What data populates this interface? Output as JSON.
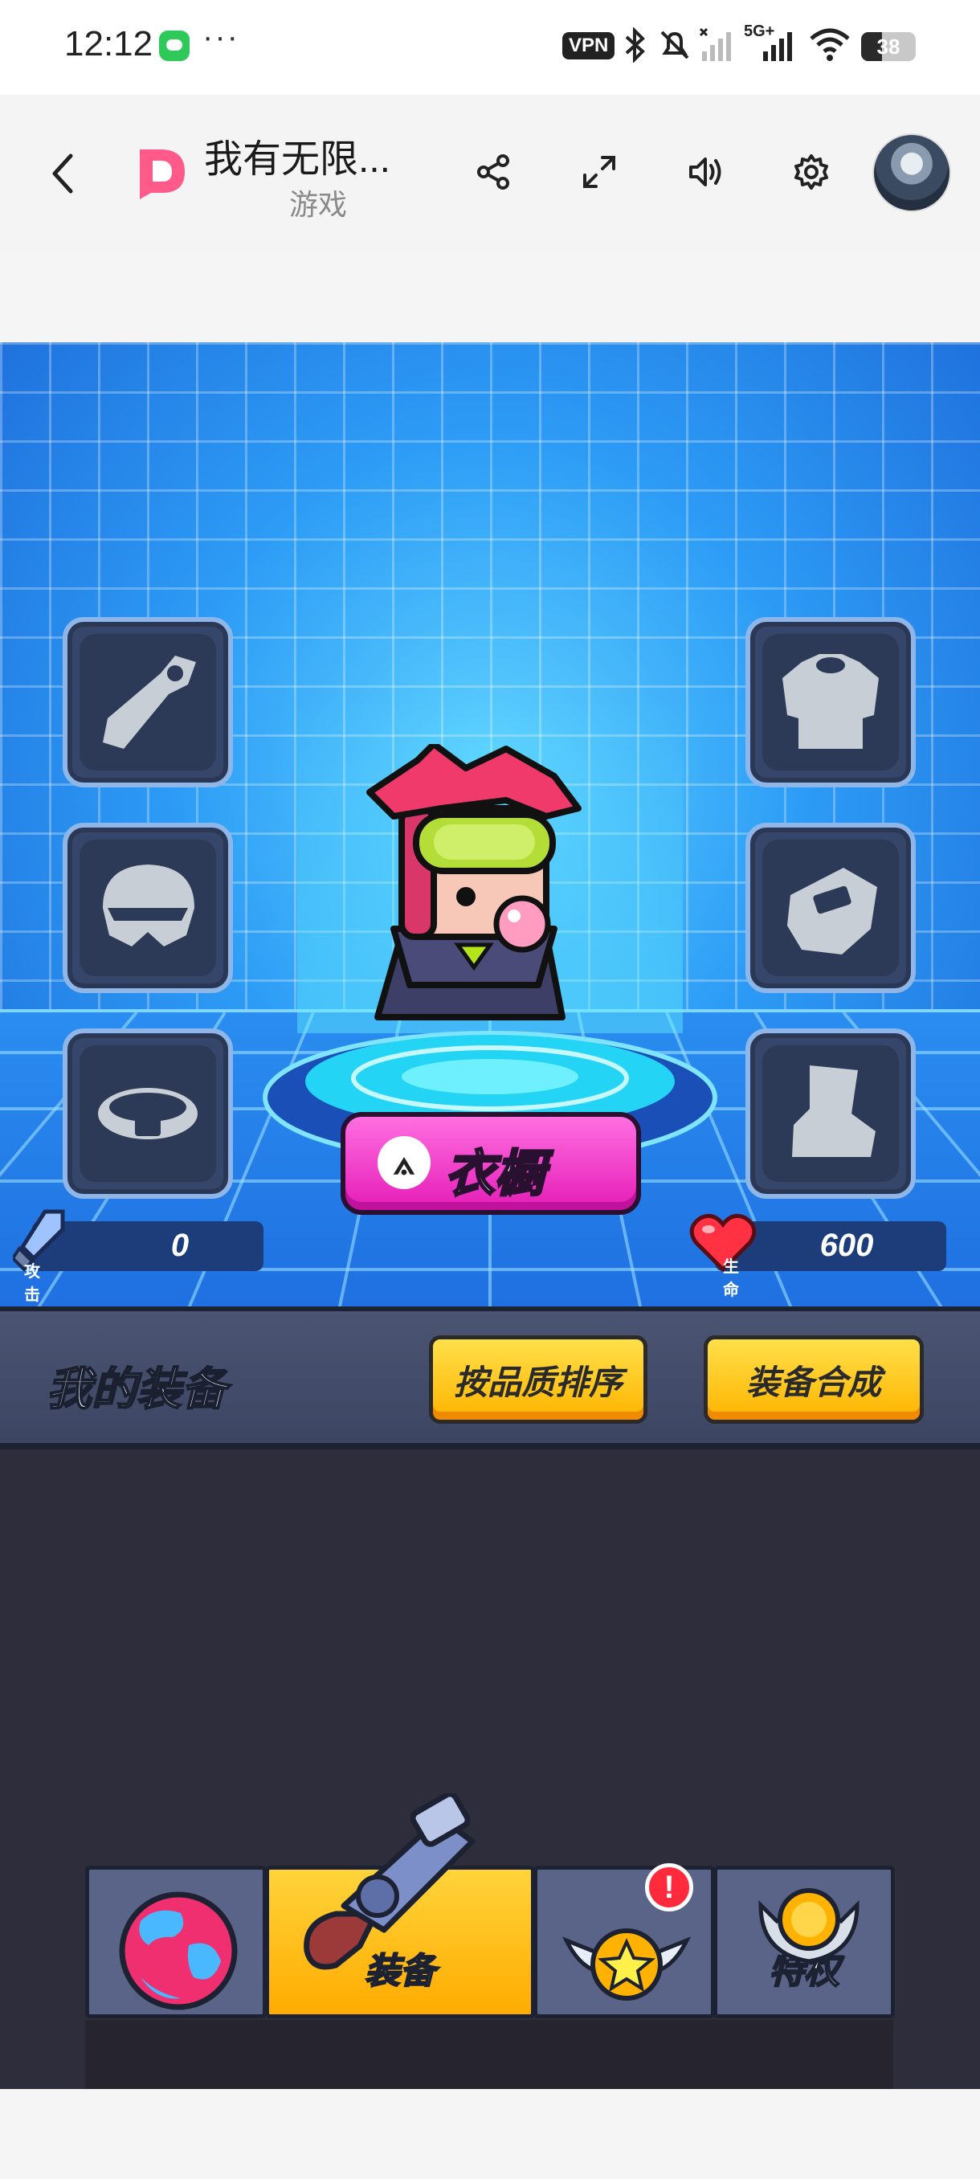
{
  "status_bar": {
    "time": "12:12",
    "more": "···",
    "vpn": "VPN",
    "network": "5G+",
    "battery": "38",
    "battery_level": 0.38
  },
  "header": {
    "title": "我有无限...",
    "subtitle": "游戏"
  },
  "game": {
    "stats": {
      "attack_label": "攻击",
      "attack_value": "0",
      "hp_label": "生命",
      "hp_value": "600"
    },
    "slots": [
      "weapon-icon",
      "helmet-icon",
      "belt-icon",
      "armor-icon",
      "glove-icon",
      "boot-icon"
    ],
    "wardrobe_button": "衣橱"
  },
  "equipment": {
    "title": "我的装备",
    "sort_button": "按品质排序",
    "craft_button": "装备合成"
  },
  "tabs": [
    {
      "label": "",
      "icon": "world-icon"
    },
    {
      "label": "装备",
      "icon": "gun-icon",
      "active": true
    },
    {
      "label": "",
      "icon": "star-medal-icon",
      "badge": "!"
    },
    {
      "label": "特权",
      "icon": "privilege-medal-icon"
    }
  ],
  "colors": {
    "accent_yellow": "#ffc31a",
    "wardrobe_pink": "#f23fcf",
    "game_blue": "#2d9cf6"
  }
}
